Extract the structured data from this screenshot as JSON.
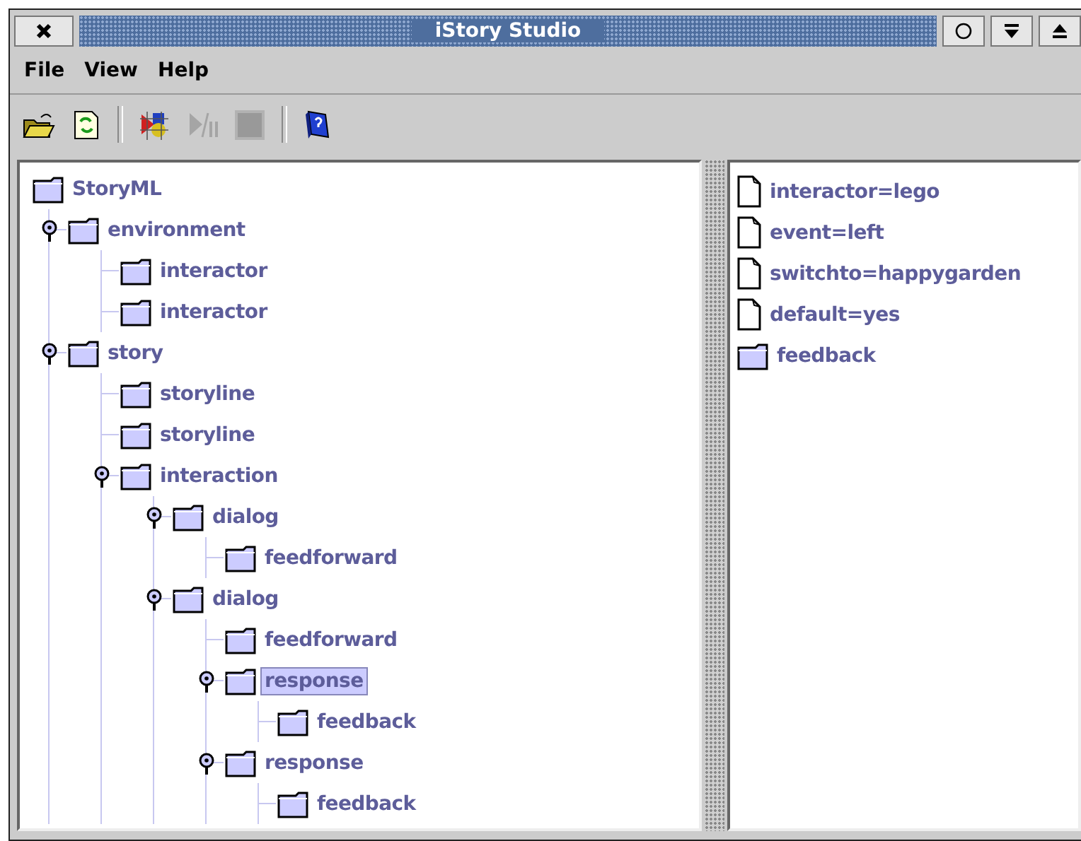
{
  "window": {
    "title": "iStory Studio"
  },
  "menu": [
    "File",
    "View",
    "Help"
  ],
  "toolbar": [
    {
      "kind": "open",
      "disabled": false
    },
    {
      "kind": "reload",
      "disabled": false
    },
    {
      "kind": "sep"
    },
    {
      "kind": "build",
      "disabled": false
    },
    {
      "kind": "playpause",
      "disabled": true
    },
    {
      "kind": "stop",
      "disabled": true
    },
    {
      "kind": "sep"
    },
    {
      "kind": "help",
      "disabled": false
    }
  ],
  "tree": {
    "label": "StoryML",
    "selected": false,
    "children": [
      {
        "label": "environment",
        "selected": false,
        "expanded": true,
        "children": [
          {
            "label": "interactor",
            "selected": false
          },
          {
            "label": "interactor",
            "selected": false
          }
        ]
      },
      {
        "label": "story",
        "selected": false,
        "expanded": true,
        "children": [
          {
            "label": "storyline",
            "selected": false
          },
          {
            "label": "storyline",
            "selected": false
          },
          {
            "label": "interaction",
            "selected": false,
            "expanded": true,
            "children": [
              {
                "label": "dialog",
                "selected": false,
                "expanded": true,
                "children": [
                  {
                    "label": "feedforward",
                    "selected": false
                  }
                ]
              },
              {
                "label": "dialog",
                "selected": false,
                "expanded": true,
                "children": [
                  {
                    "label": "feedforward",
                    "selected": false
                  },
                  {
                    "label": "response",
                    "selected": true,
                    "expanded": true,
                    "children": [
                      {
                        "label": "feedback",
                        "selected": false
                      }
                    ]
                  },
                  {
                    "label": "response",
                    "selected": false,
                    "expanded": true,
                    "children": [
                      {
                        "label": "feedback",
                        "selected": false
                      }
                    ]
                  }
                ]
              }
            ]
          }
        ]
      }
    ]
  },
  "details": [
    {
      "kind": "attribute",
      "label": "interactor=lego"
    },
    {
      "kind": "attribute",
      "label": "event=left"
    },
    {
      "kind": "attribute",
      "label": "switchto=happygarden"
    },
    {
      "kind": "attribute",
      "label": "default=yes"
    },
    {
      "kind": "element",
      "label": "feedback"
    }
  ]
}
